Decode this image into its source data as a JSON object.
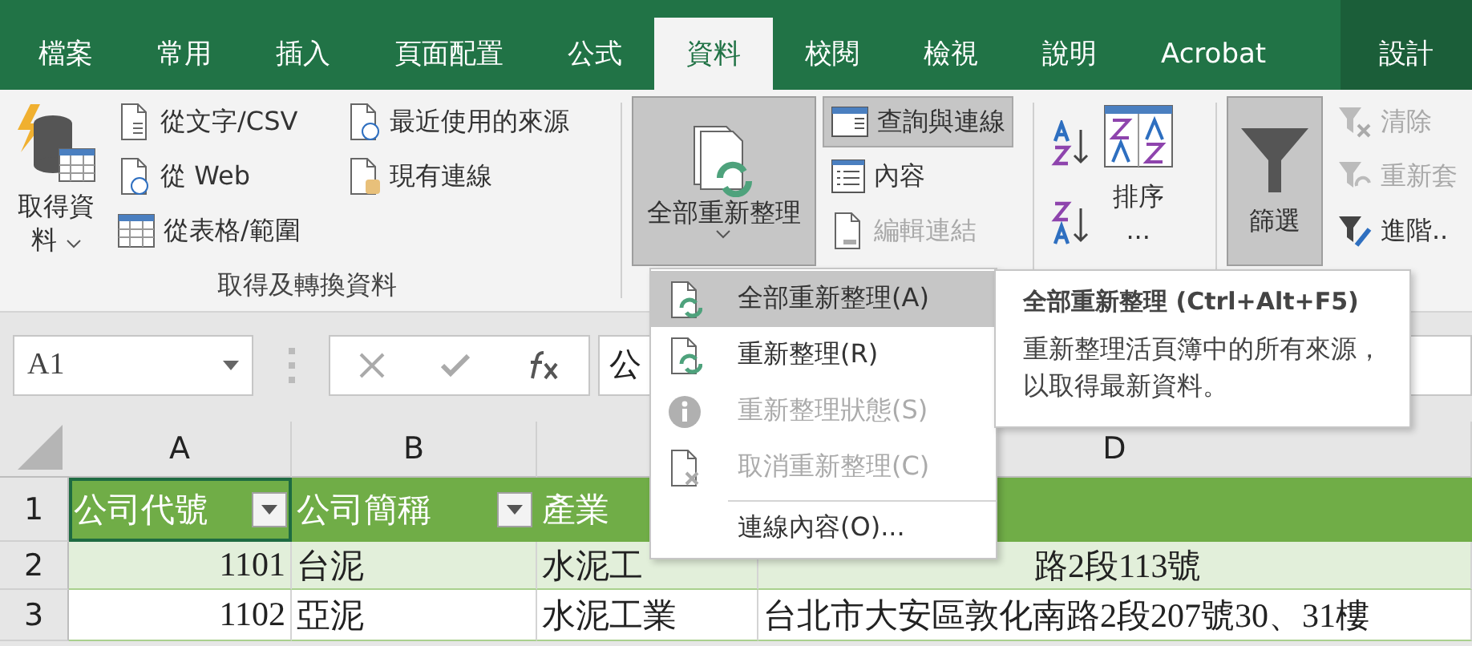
{
  "tabs": [
    {
      "label": "檔案",
      "selected": false,
      "kind": "normal"
    },
    {
      "label": "常用",
      "selected": false,
      "kind": "normal"
    },
    {
      "label": "插入",
      "selected": false,
      "kind": "normal"
    },
    {
      "label": "頁面配置",
      "selected": false,
      "kind": "normal"
    },
    {
      "label": "公式",
      "selected": false,
      "kind": "normal"
    },
    {
      "label": "資料",
      "selected": true,
      "kind": "normal"
    },
    {
      "label": "校閱",
      "selected": false,
      "kind": "normal"
    },
    {
      "label": "檢視",
      "selected": false,
      "kind": "normal"
    },
    {
      "label": "說明",
      "selected": false,
      "kind": "normal"
    },
    {
      "label": "Acrobat",
      "selected": false,
      "kind": "normal"
    },
    {
      "label": "設計",
      "selected": false,
      "kind": "contextual"
    }
  ],
  "ribbon": {
    "get_transform": {
      "label": "取得及轉換資料",
      "get_data": [
        "取得資",
        "料"
      ],
      "commands": [
        "從文字/CSV",
        "從 Web",
        "從表格/範圍",
        "最近使用的來源",
        "現有連線"
      ]
    },
    "queries": {
      "refresh_all": {
        "label": "全部重新整理",
        "pressed": true
      },
      "commands": [
        {
          "label": "查詢與連線",
          "pressed": true,
          "disabled": false
        },
        {
          "label": "內容",
          "pressed": false,
          "disabled": false
        },
        {
          "label": "編輯連結",
          "pressed": false,
          "disabled": true
        }
      ]
    },
    "sort": {
      "label_lines": [
        "排序",
        "..."
      ]
    },
    "filter": {
      "label": "篩選",
      "pressed": true,
      "commands": [
        {
          "label": "清除",
          "disabled": true
        },
        {
          "label": "重新套",
          "disabled": true
        },
        {
          "label": "進階..",
          "disabled": false
        }
      ]
    }
  },
  "formula_bar": {
    "name_box": "A1",
    "value": "公"
  },
  "sheet": {
    "columns": [
      "A",
      "B",
      "",
      "D"
    ],
    "header_row": {
      "number": "1",
      "cells": [
        {
          "text": "公司代號",
          "filter": true,
          "selected": true
        },
        {
          "text": "公司簡稱",
          "filter": true,
          "selected": false
        },
        {
          "text": "產業",
          "selected": false
        }
      ]
    },
    "rows": [
      {
        "number": "2",
        "banded": true,
        "covered_by_menu": true,
        "cells": [
          "1101",
          "台泥",
          "水泥工",
          "路2段113號"
        ]
      },
      {
        "number": "3",
        "banded": false,
        "covered_by_menu": false,
        "cells": [
          "1102",
          "亞泥",
          "水泥工業",
          "台北市大安區敦化南路2段207號30、31樓"
        ]
      }
    ]
  },
  "menu": {
    "items": [
      {
        "label": "全部重新整理(A)",
        "selected": true,
        "disabled": false,
        "separator_before": false
      },
      {
        "label": "重新整理(R)",
        "selected": false,
        "disabled": false,
        "separator_before": false
      },
      {
        "label": "重新整理狀態(S)",
        "selected": false,
        "disabled": true,
        "separator_before": false
      },
      {
        "label": "取消重新整理(C)",
        "selected": false,
        "disabled": true,
        "separator_before": false
      },
      {
        "label": "連線內容(O)...",
        "selected": false,
        "disabled": false,
        "separator_before": true
      }
    ]
  },
  "tooltip": {
    "title": "全部重新整理 (Ctrl+Alt+F5)",
    "body": "重新整理活頁簿中的所有來源，以取得最新資料。"
  }
}
